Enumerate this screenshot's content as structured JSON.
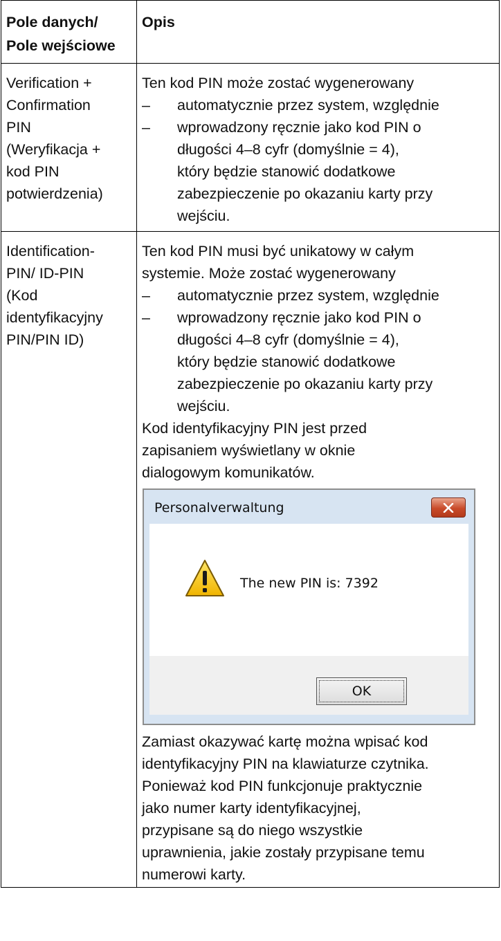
{
  "table": {
    "headers": [
      "Pole danych/ Pole wejściowe",
      "Opis"
    ],
    "header_col1_lines": [
      "Pole danych/",
      "Pole wejściowe"
    ],
    "rows": [
      {
        "field_lines": [
          "Verification +",
          "Confirmation",
          "PIN",
          "(Weryfikacja +",
          "kod PIN",
          "potwierdzenia)"
        ],
        "intro_lines": [
          "Ten kod PIN może zostać wygenerowany"
        ],
        "bullets": [
          {
            "dash": "–",
            "lines": [
              "automatycznie przez system, względnie"
            ]
          },
          {
            "dash": "–",
            "lines": [
              "wprowadzony ręcznie jako kod PIN o",
              "długości 4–8 cyfr (domyślnie = 4),",
              "który będzie stanowić dodatkowe",
              "zabezpieczenie po okazaniu karty przy",
              "wejściu."
            ]
          }
        ]
      },
      {
        "field_lines": [
          "Identification-",
          "PIN/ ID-PIN",
          "(Kod",
          "identyfikacyjny",
          "PIN/PIN ID)"
        ],
        "intro_lines": [
          "Ten kod PIN musi być unikatowy w całym",
          "systemie. Może zostać wygenerowany"
        ],
        "bullets": [
          {
            "dash": "–",
            "lines": [
              "automatycznie przez system, względnie"
            ]
          },
          {
            "dash": "–",
            "lines": [
              "wprowadzony ręcznie jako kod PIN o",
              "długości 4–8 cyfr (domyślnie = 4),",
              "który będzie stanowić dodatkowe",
              "zabezpieczenie po okazaniu karty przy",
              "wejściu."
            ]
          }
        ],
        "after_bullets_lines": [
          "Kod identyfikacyjny PIN jest przed",
          "zapisaniem wyświetlany w oknie",
          "dialogowym komunikatów."
        ],
        "closing_lines": [
          "Zamiast okazywać kartę można wpisać kod",
          "identyfikacyjny PIN na klawiaturze czytnika.",
          "Ponieważ kod PIN funkcjonuje praktycznie",
          "jako numer karty identyfikacyjnej,",
          "przypisane są do niego wszystkie",
          "uprawnienia, jakie zostały przypisane temu",
          "numerowi karty."
        ]
      }
    ]
  },
  "dialog": {
    "title": "Personalverwaltung",
    "message": "The new PIN is: 7392",
    "ok_label": "OK",
    "icons": {
      "close": "close-icon",
      "warning": "warning-icon"
    },
    "colors": {
      "close_button": "#c94b2a",
      "frame": "#d7e4f2",
      "warning_fill": "#f5c400"
    }
  }
}
